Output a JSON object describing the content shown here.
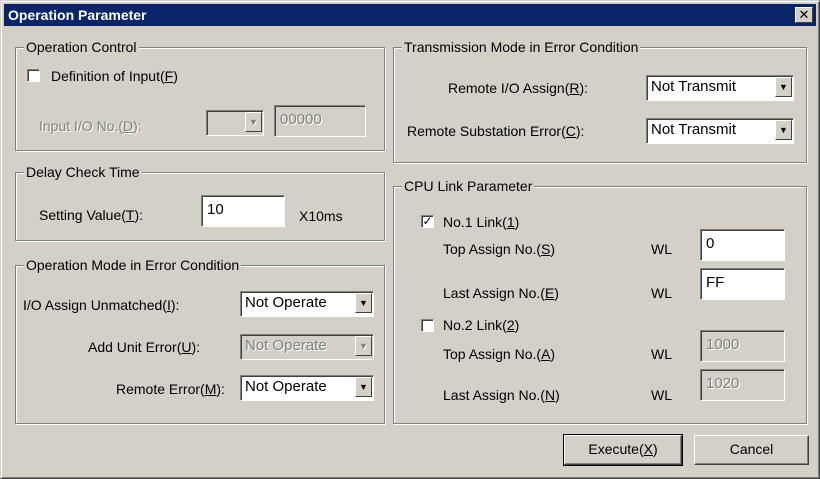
{
  "window": {
    "title": "Operation Parameter",
    "close_glyph": "✕"
  },
  "operation_control": {
    "title": "Operation Control",
    "definition_checkbox_label_pre": "Definition of Input(",
    "definition_checkbox_label_key": "F",
    "definition_checkbox_label_post": ")",
    "definition_checked": false,
    "input_io_label_pre": "Input I/O No.(",
    "input_io_label_key": "D",
    "input_io_label_post": "):",
    "input_io_select": "",
    "input_io_value": "00000"
  },
  "delay_check": {
    "title": "Delay Check Time",
    "setting_label_pre": "Setting Value(",
    "setting_label_key": "T",
    "setting_label_post": "):",
    "setting_value": "10",
    "unit": "X10ms"
  },
  "operation_mode": {
    "title": "Operation Mode in Error Condition",
    "io_assign_pre": "I/O Assign Unmatched(",
    "io_assign_key": "I",
    "io_assign_post": "):",
    "io_assign_value": "Not Operate",
    "add_unit_pre": "Add Unit Error(",
    "add_unit_key": "U",
    "add_unit_post": "):",
    "add_unit_value": "Not Operate",
    "remote_pre": "Remote Error(",
    "remote_key": "M",
    "remote_post": "):",
    "remote_value": "Not Operate"
  },
  "transmission": {
    "title": "Transmission Mode in Error Condition",
    "remote_io_pre": "Remote I/O Assign(",
    "remote_io_key": "R",
    "remote_io_post": "):",
    "remote_io_value": "Not Transmit",
    "remote_sub_pre": "Remote Substation Error(",
    "remote_sub_key": "C",
    "remote_sub_post": "):",
    "remote_sub_value": "Not Transmit"
  },
  "cpu_link": {
    "title": "CPU Link Parameter",
    "link1_pre": "No.1 Link(",
    "link1_key": "1",
    "link1_post": ")",
    "link1_checked": true,
    "link1_top_pre": "Top Assign No.(",
    "link1_top_key": "S",
    "link1_top_post": ")",
    "link1_top_value": "0",
    "link1_last_pre": "Last Assign No.(",
    "link1_last_key": "E",
    "link1_last_post": ")",
    "link1_last_value": "FF",
    "link2_pre": "No.2 Link(",
    "link2_key": "2",
    "link2_post": ")",
    "link2_checked": false,
    "link2_top_pre": "Top Assign No.(",
    "link2_top_key": "A",
    "link2_top_post": ")",
    "link2_top_value": "1000",
    "link2_last_pre": "Last Assign No.(",
    "link2_last_key": "N",
    "link2_last_post": ")",
    "link2_last_value": "1020",
    "wl": "WL",
    "check_glyph": "✓"
  },
  "buttons": {
    "execute_pre": "Execute(",
    "execute_key": "X",
    "execute_post": ")",
    "cancel": "Cancel"
  },
  "dropdown_glyph": "▼"
}
